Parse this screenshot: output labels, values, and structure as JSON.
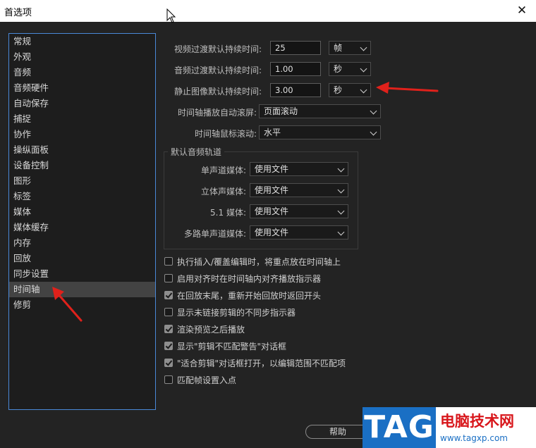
{
  "window": {
    "title": "首选项",
    "close_glyph": "✕"
  },
  "sidebar": {
    "items": [
      {
        "label": "常规"
      },
      {
        "label": "外观"
      },
      {
        "label": "音频"
      },
      {
        "label": "音频硬件"
      },
      {
        "label": "自动保存"
      },
      {
        "label": "捕捉"
      },
      {
        "label": "协作"
      },
      {
        "label": "操纵面板"
      },
      {
        "label": "设备控制"
      },
      {
        "label": "图形"
      },
      {
        "label": "标签"
      },
      {
        "label": "媒体"
      },
      {
        "label": "媒体缓存"
      },
      {
        "label": "内存"
      },
      {
        "label": "回放"
      },
      {
        "label": "同步设置"
      },
      {
        "label": "时间轴"
      },
      {
        "label": "修剪"
      }
    ],
    "selected": "时间轴"
  },
  "timeline": {
    "video_transition": {
      "label": "视频过渡默认持续时间:",
      "value": "25",
      "unit": "帧"
    },
    "audio_transition": {
      "label": "音频过渡默认持续时间:",
      "value": "1.00",
      "unit": "秒"
    },
    "still_image": {
      "label": "静止图像默认持续时间:",
      "value": "3.00",
      "unit": "秒"
    },
    "playback_autoscroll": {
      "label": "时间轴播放自动滚屏:",
      "value": "页面滚动"
    },
    "mouse_scroll": {
      "label": "时间轴鼠标滚动:",
      "value": "水平"
    },
    "default_audio_tracks": {
      "title": "默认音频轨道",
      "mono": {
        "label": "单声道媒体:",
        "value": "使用文件"
      },
      "stereo": {
        "label": "立体声媒体:",
        "value": "使用文件"
      },
      "surround": {
        "label": "5.1 媒体:",
        "value": "使用文件"
      },
      "multi_mono": {
        "label": "多路单声道媒体:",
        "value": "使用文件"
      }
    },
    "checkboxes": [
      {
        "label": "执行插入/覆盖编辑时，将重点放在时间轴上",
        "checked": false
      },
      {
        "label": "启用对齐时在时间轴内对齐播放指示器",
        "checked": false
      },
      {
        "label": "在回放末尾，重新开始回放时返回开头",
        "checked": true
      },
      {
        "label": "显示未链接剪辑的不同步指示器",
        "checked": false
      },
      {
        "label": "渲染预览之后播放",
        "checked": true
      },
      {
        "label": "显示\"剪辑不匹配警告\"对话框",
        "checked": true
      },
      {
        "label": "\"适合剪辑\"对话框打开，以编辑范围不匹配项",
        "checked": true
      },
      {
        "label": "匹配帧设置入点",
        "checked": false
      }
    ]
  },
  "footer": {
    "help_label": "帮助"
  },
  "watermark": {
    "tag": "TAG",
    "site_name": "电脑技术网",
    "url": "www.tagxp.com"
  },
  "colors": {
    "accent_border": "#4a88d8",
    "arrow": "#e0211b",
    "watermark_blue": "#1a6fc4",
    "watermark_red": "#d8161b"
  }
}
